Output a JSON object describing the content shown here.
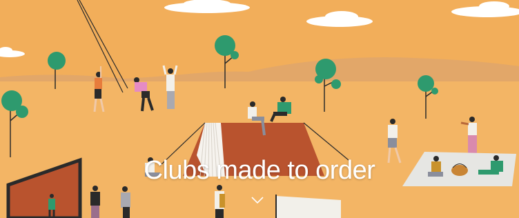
{
  "hero": {
    "headline": "Clubs made to order",
    "scroll_icon": "chevron-down-icon",
    "colors": {
      "sky": "#f2ae5a",
      "ground": "#f3b565",
      "hills": "#e2a769",
      "tree": "#2e9a6e",
      "tent": "#b9532e",
      "blanket": "#e6e6e3",
      "frame": "#2a2a2a",
      "text": "#ffffff"
    }
  }
}
